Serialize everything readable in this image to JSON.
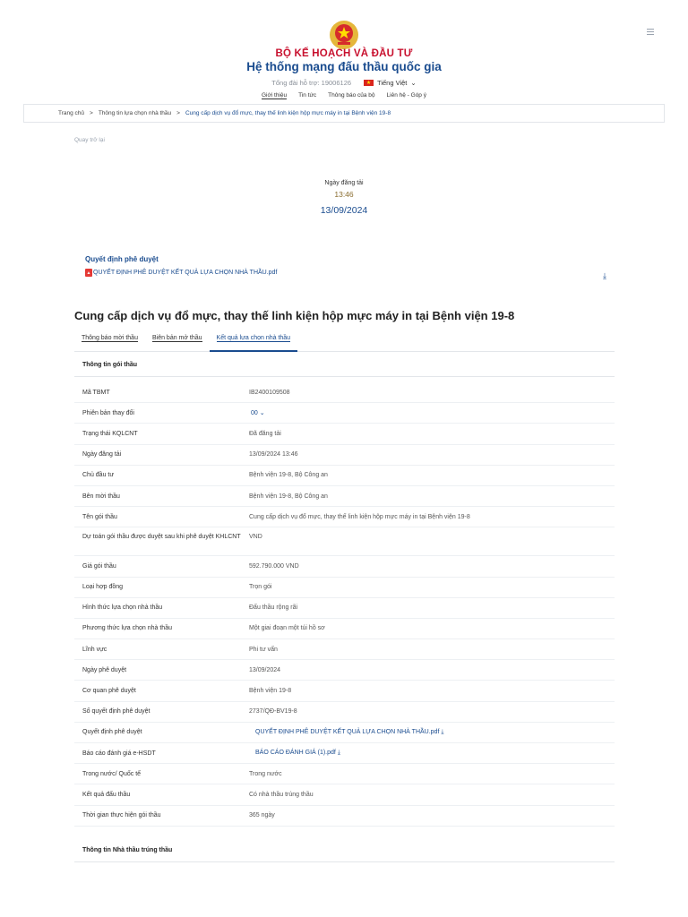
{
  "header": {
    "ministry": "BỘ KẾ HOẠCH VÀ ĐẦU TƯ",
    "system_title": "Hệ thống mạng đấu thầu quốc gia",
    "support": "Tổng đài hỗ trợ: 19006126",
    "language": "Tiếng Việt",
    "language_icon": "chevron-down-icon"
  },
  "nav": [
    "Giới thiệu",
    "Tin tức",
    "Thông báo của bộ",
    "Liên hệ - Góp ý"
  ],
  "breadcrumb": {
    "home": "Trang chủ",
    "section": "Thông tin lựa chọn nhà thầu",
    "current": "Cung cấp dịch vụ đổ mực, thay thế linh kiện hộp mực máy in tại Bệnh viện 19-8"
  },
  "back": "Quay trở lại",
  "publish": {
    "label": "Ngày đăng tải",
    "time": "13:46",
    "date": "13/09/2024"
  },
  "decision": {
    "title": "Quyết định phê duyệt",
    "file": "QUYẾT ĐỊNH PHÊ DUYỆT KẾT QUẢ LỰA CHỌN NHÀ THẦU.pdf"
  },
  "package_title": "Cung cấp dịch vụ đổ mực, thay thế linh kiện hộp mực máy in tại Bệnh viện 19-8",
  "tabs": [
    "Thông báo mời thầu",
    "Biên bản mở thầu",
    "Kết quả lựa chọn nhà thầu"
  ],
  "active_tab": 2,
  "section_info": "Thông tin gói thầu",
  "section_winner": "Thông tin Nhà thầu trúng thầu",
  "rows": [
    {
      "label": "Mã TBMT",
      "value": "IB2400109508"
    },
    {
      "label": "Phiên bản thay đổi",
      "value": "00"
    },
    {
      "label": "Trạng thái KQLCNT",
      "value": "Đã đăng tải"
    },
    {
      "label": "Ngày đăng tải",
      "value": "13/09/2024 13:46"
    },
    {
      "label": "Chủ đầu tư",
      "value": "Bệnh viện 19-8, Bộ Công an"
    },
    {
      "label": "Bên mời thầu",
      "value": "Bệnh viện 19-8, Bộ Công an"
    },
    {
      "label": "Tên gói thầu",
      "value": "Cung cấp dịch vụ đổ mực, thay thế linh kiện hộp mực máy in tại Bệnh viện 19-8"
    },
    {
      "label": "Dự toán gói thầu được duyệt sau khi phê duyệt KHLCNT",
      "value": "VND"
    },
    {
      "label": "Giá gói thầu",
      "value": "592.790.000 VND"
    },
    {
      "label": "Loại hợp đồng",
      "value": "Trọn gói"
    },
    {
      "label": "Hình thức lựa chọn nhà thầu",
      "value": "Đấu thầu rộng rãi"
    },
    {
      "label": "Phương thức lựa chọn nhà thầu",
      "value": "Một giai đoạn một túi hồ sơ"
    },
    {
      "label": "Lĩnh vực",
      "value": "Phi tư vấn"
    },
    {
      "label": "Ngày phê duyệt",
      "value": "13/09/2024"
    },
    {
      "label": "Cơ quan phê duyệt",
      "value": "Bệnh viện 19-8"
    },
    {
      "label": "Số quyết định phê duyệt",
      "value": "2737/QĐ-BV19-8"
    },
    {
      "label": "Quyết định phê duyệt",
      "value": "QUYẾT ĐỊNH PHÊ DUYỆT KẾT QUẢ LỰA CHỌN NHÀ THẦU.pdf"
    },
    {
      "label": "Báo cáo đánh giá e-HSDT",
      "value": "BÁO CÁO ĐÁNH GIÁ (1).pdf"
    },
    {
      "label": "Trong nước/ Quốc tế",
      "value": "Trong nước"
    },
    {
      "label": "Kết quả đấu thầu",
      "value": "Có nhà thầu trúng thầu"
    },
    {
      "label": "Thời gian thực hiện gói thầu",
      "value": "365 ngày"
    }
  ],
  "colors": {
    "brand_red": "#c8102e",
    "brand_blue": "#1a4c8f"
  }
}
